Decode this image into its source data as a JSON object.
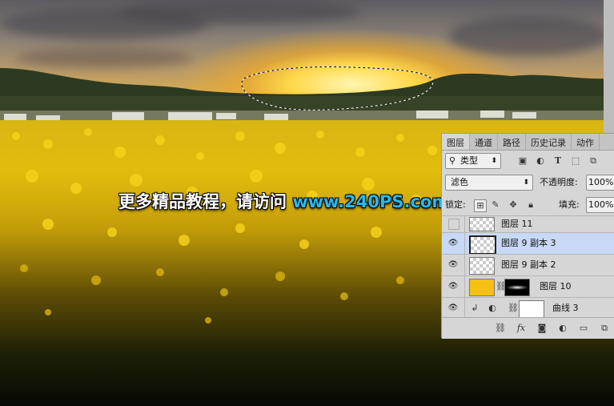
{
  "watermark": {
    "text_cn": "更多精品教程，请访问",
    "text_url": "www.240PS.com"
  },
  "layers_panel": {
    "tabs": [
      "图层",
      "通道",
      "路径",
      "历史记录",
      "动作"
    ],
    "active_tab": "图层",
    "filter": {
      "kind_label": "类型"
    },
    "blend_mode": "滤色",
    "opacity_label": "不透明度:",
    "opacity_value": "100%",
    "lock_label": "锁定:",
    "fill_label": "填充:",
    "fill_value": "100%",
    "layers": [
      {
        "name": "图层 11",
        "visible": false,
        "selected": false
      },
      {
        "name": "图层 9 副本 3",
        "visible": true,
        "selected": true
      },
      {
        "name": "图层 9 副本 2",
        "visible": true,
        "selected": false
      },
      {
        "name": "图层 10",
        "visible": true,
        "selected": false
      },
      {
        "name": "曲线 3",
        "visible": true,
        "selected": false
      }
    ],
    "footer_icons": [
      "link-icon",
      "fx-icon",
      "mask-icon",
      "adjustment-icon",
      "folder-icon",
      "new-layer-icon"
    ]
  },
  "colors": {
    "selected_layer": "#c8d9f6",
    "watermark_url": "#27b9f0",
    "layer10_fill": "#f6c015"
  }
}
